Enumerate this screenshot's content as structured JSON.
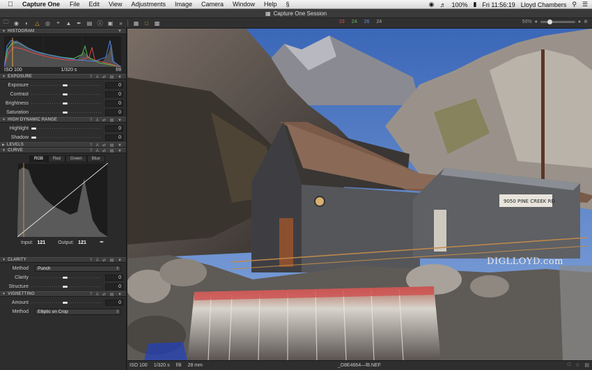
{
  "menubar": {
    "apple_icon": "apple-icon",
    "app_name": "Capture One",
    "menus": [
      "File",
      "Edit",
      "View",
      "Adjustments",
      "Image",
      "Camera",
      "Window",
      "Help"
    ],
    "battery": "100%",
    "datetime": "Fri 11:56:19",
    "user": "Lloyd Chambers"
  },
  "window": {
    "title": "Capture One Session"
  },
  "toolbar": {
    "counts": {
      "red": "23",
      "green": "24",
      "blue": "26",
      "all": "24"
    },
    "zoom": "50%"
  },
  "histogram": {
    "title": "HISTOGRAM",
    "iso": "ISO 100",
    "shutter": "1/320 s",
    "aperture": "f/8"
  },
  "exposure": {
    "title": "EXPOSURE",
    "rows": [
      {
        "label": "Exposure",
        "value": "0"
      },
      {
        "label": "Contrast",
        "value": "0"
      },
      {
        "label": "Brightness",
        "value": "0"
      },
      {
        "label": "Saturation",
        "value": "0"
      }
    ]
  },
  "hdr": {
    "title": "HIGH DYNAMIC RANGE",
    "rows": [
      {
        "label": "Highlight",
        "value": "0"
      },
      {
        "label": "Shadow",
        "value": "0"
      }
    ]
  },
  "levels": {
    "title": "LEVELS"
  },
  "curve": {
    "title": "CURVE",
    "tabs": [
      "RGB",
      "Red",
      "Green",
      "Blue"
    ],
    "input_label": "Input:",
    "input_value": "121",
    "output_label": "Output:",
    "output_value": "121"
  },
  "clarity": {
    "title": "CLARITY",
    "method_label": "Method",
    "method_value": "Punch",
    "rows": [
      {
        "label": "Clarity",
        "value": "0"
      },
      {
        "label": "Structure",
        "value": "0"
      }
    ]
  },
  "vignetting": {
    "title": "VIGNETTING",
    "amount_label": "Amount",
    "amount_value": "0",
    "method_label": "Method",
    "method_value": "Elliptic on Crop"
  },
  "viewer": {
    "watermark": "DIGLLOYD.com"
  },
  "status": {
    "iso": "ISO 100",
    "shutter": "1/320 s",
    "aperture": "f/8",
    "focal": "28 mm",
    "filename": "_D8E4664—f8.NEF"
  },
  "colors": {
    "accent": "#f0a030",
    "panel": "#2d2d2d",
    "header": "#3b3b3b"
  }
}
